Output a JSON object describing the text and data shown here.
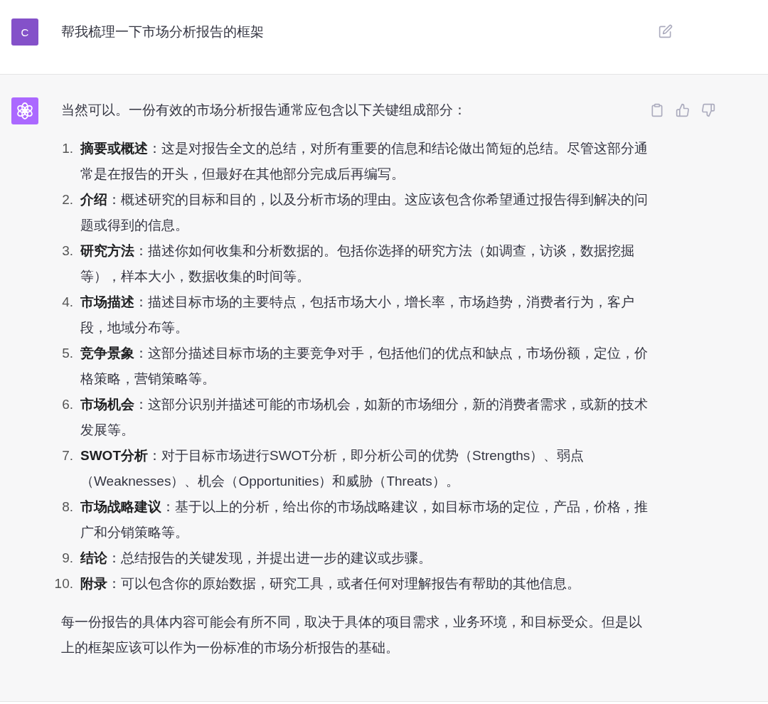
{
  "user_message": {
    "avatar": "C",
    "text": "帮我梳理一下市场分析报告的框架"
  },
  "assistant_message": {
    "intro": "当然可以。一份有效的市场分析报告通常应包含以下关键组成部分：",
    "items": [
      {
        "number": "1.",
        "term": "摘要或概述",
        "text": "：这是对报告全文的总结，对所有重要的信息和结论做出简短的总结。尽管这部分通常是在报告的开头，但最好在其他部分完成后再编写。"
      },
      {
        "number": "2.",
        "term": "介绍",
        "text": "：概述研究的目标和目的，以及分析市场的理由。这应该包含你希望通过报告得到解决的问题或得到的信息。"
      },
      {
        "number": "3.",
        "term": "研究方法",
        "text": "：描述你如何收集和分析数据的。包括你选择的研究方法（如调查，访谈，数据挖掘等），样本大小，数据收集的时间等。"
      },
      {
        "number": "4.",
        "term": "市场描述",
        "text": "：描述目标市场的主要特点，包括市场大小，增长率，市场趋势，消费者行为，客户段，地域分布等。"
      },
      {
        "number": "5.",
        "term": "竞争景象",
        "text": "：这部分描述目标市场的主要竞争对手，包括他们的优点和缺点，市场份额，定位，价格策略，营销策略等。"
      },
      {
        "number": "6.",
        "term": "市场机会",
        "text": "：这部分识别并描述可能的市场机会，如新的市场细分，新的消费者需求，或新的技术发展等。"
      },
      {
        "number": "7.",
        "term": "SWOT分析",
        "text": "：对于目标市场进行SWOT分析，即分析公司的优势（Strengths）、弱点（Weaknesses）、机会（Opportunities）和威胁（Threats）。"
      },
      {
        "number": "8.",
        "term": "市场战略建议",
        "text": "：基于以上的分析，给出你的市场战略建议，如目标市场的定位，产品，价格，推广和分销策略等。"
      },
      {
        "number": "9.",
        "term": "结论",
        "text": "：总结报告的关键发现，并提出进一步的建议或步骤。"
      },
      {
        "number": "10.",
        "term": "附录",
        "text": "：可以包含你的原始数据，研究工具，或者任何对理解报告有帮助的其他信息。"
      }
    ],
    "closing": "每一份报告的具体内容可能会有所不同，取决于具体的项目需求，业务环境，和目标受众。但是以上的框架应该可以作为一份标准的市场分析报告的基础。"
  }
}
